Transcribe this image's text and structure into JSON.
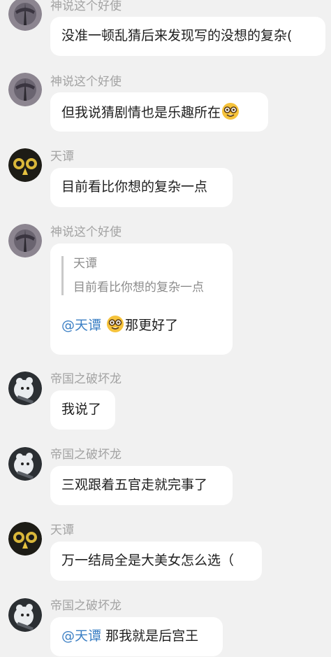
{
  "users": {
    "shenshuo": "神说这个好使",
    "tiantan": "天谭",
    "diguo": "帝国之破坏龙"
  },
  "messages": [
    {
      "sender": "神说这个好使",
      "text": "没准一顿乱猜后来发现写的没想的复杂("
    },
    {
      "sender": "神说这个好使",
      "text": "但我说猜剧情也是乐趣所在",
      "emoji": "nerd-face-emoji"
    },
    {
      "sender": "天谭",
      "text": "目前看比你想的复杂一点"
    },
    {
      "sender": "神说这个好使",
      "quote": {
        "sender": "天谭",
        "text": "目前看比你想的复杂一点"
      },
      "mention": "@天谭",
      "emoji": "nerd-face-emoji",
      "text": "那更好了"
    },
    {
      "sender": "帝国之破坏龙",
      "text": "我说了"
    },
    {
      "sender": "帝国之破坏龙",
      "text": "三观跟着五官走就完事了"
    },
    {
      "sender": "天谭",
      "text": "万一结局全是大美女怎么选（"
    },
    {
      "sender": "帝国之破坏龙",
      "mention": "@天谭",
      "text": "那我就是后宫王"
    }
  ]
}
